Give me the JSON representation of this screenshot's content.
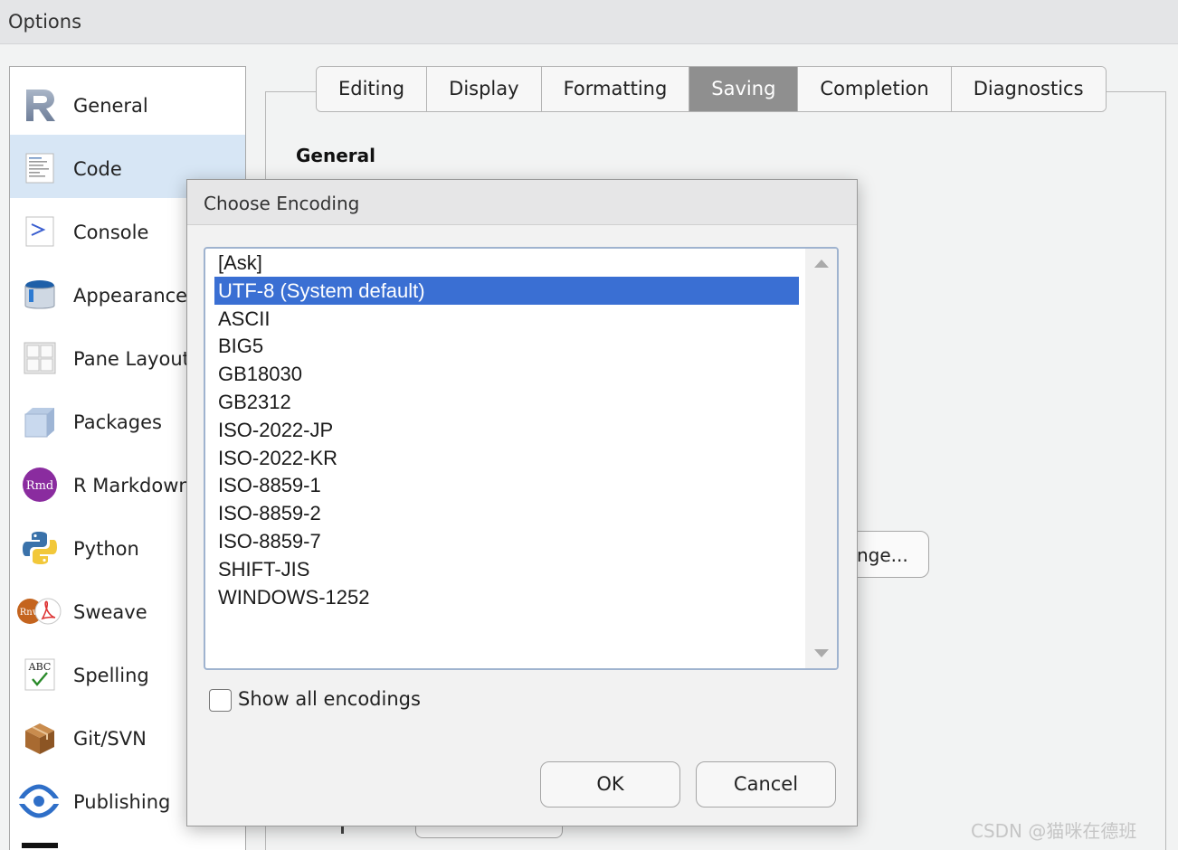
{
  "window": {
    "title": "Options"
  },
  "sidebar": {
    "items": [
      {
        "label": "General",
        "icon": "r-logo-icon"
      },
      {
        "label": "Code",
        "icon": "code-icon",
        "selected": true
      },
      {
        "label": "Console",
        "icon": "console-icon"
      },
      {
        "label": "Appearance",
        "icon": "paint-bucket-icon"
      },
      {
        "label": "Pane Layout",
        "icon": "pane-layout-icon"
      },
      {
        "label": "Packages",
        "icon": "package-box-icon"
      },
      {
        "label": "R Markdown",
        "icon": "rmd-icon"
      },
      {
        "label": "Python",
        "icon": "python-icon"
      },
      {
        "label": "Sweave",
        "icon": "sweave-icon"
      },
      {
        "label": "Spelling",
        "icon": "spelling-icon"
      },
      {
        "label": "Git/SVN",
        "icon": "git-box-icon"
      },
      {
        "label": "Publishing",
        "icon": "publishing-icon"
      }
    ]
  },
  "tabs": [
    {
      "label": "Editing"
    },
    {
      "label": "Display"
    },
    {
      "label": "Formatting"
    },
    {
      "label": "Saving",
      "active": true
    },
    {
      "label": "Completion"
    },
    {
      "label": "Diagnostics"
    }
  ],
  "panel": {
    "section_heading": "General",
    "change_button_partial": "nge..."
  },
  "dialog": {
    "title": "Choose Encoding",
    "encodings": [
      "[Ask]",
      "UTF-8 (System default)",
      "ASCII",
      "BIG5",
      "GB18030",
      "GB2312",
      "ISO-2022-JP",
      "ISO-2022-KR",
      "ISO-8859-1",
      "ISO-8859-2",
      "ISO-8859-7",
      "SHIFT-JIS",
      "WINDOWS-1252"
    ],
    "selected_encoding": "UTF-8 (System default)",
    "show_all_label": "Show all encodings",
    "show_all_checked": false,
    "ok_label": "OK",
    "cancel_label": "Cancel"
  },
  "watermark": "CSDN @猫咪在德班",
  "colors": {
    "selection": "#3a6fd3",
    "sidebar_selected": "#d7e6f5",
    "active_tab": "#8f8f8f"
  }
}
